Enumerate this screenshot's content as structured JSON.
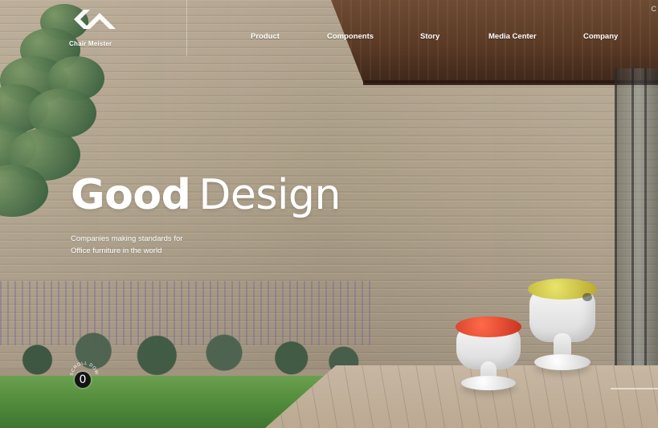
{
  "brand": {
    "name": "Chair Meister"
  },
  "nav": {
    "items": [
      "Product",
      "Components",
      "Story",
      "Media Center",
      "Company"
    ],
    "top_right": "C"
  },
  "hero": {
    "title_strong": "Good",
    "title_light": "Design",
    "subtitle_line1": "Companies making standards for",
    "subtitle_line2": "Office furniture in the world"
  },
  "scroll": {
    "label": "SCROLL DOWN",
    "count": "0"
  },
  "colors": {
    "text": "#ffffff",
    "roof": "#5a3a25",
    "grass": "#4f8a3a",
    "chair_red": "#e2452f",
    "chair_yellow": "#d9cf4c"
  }
}
